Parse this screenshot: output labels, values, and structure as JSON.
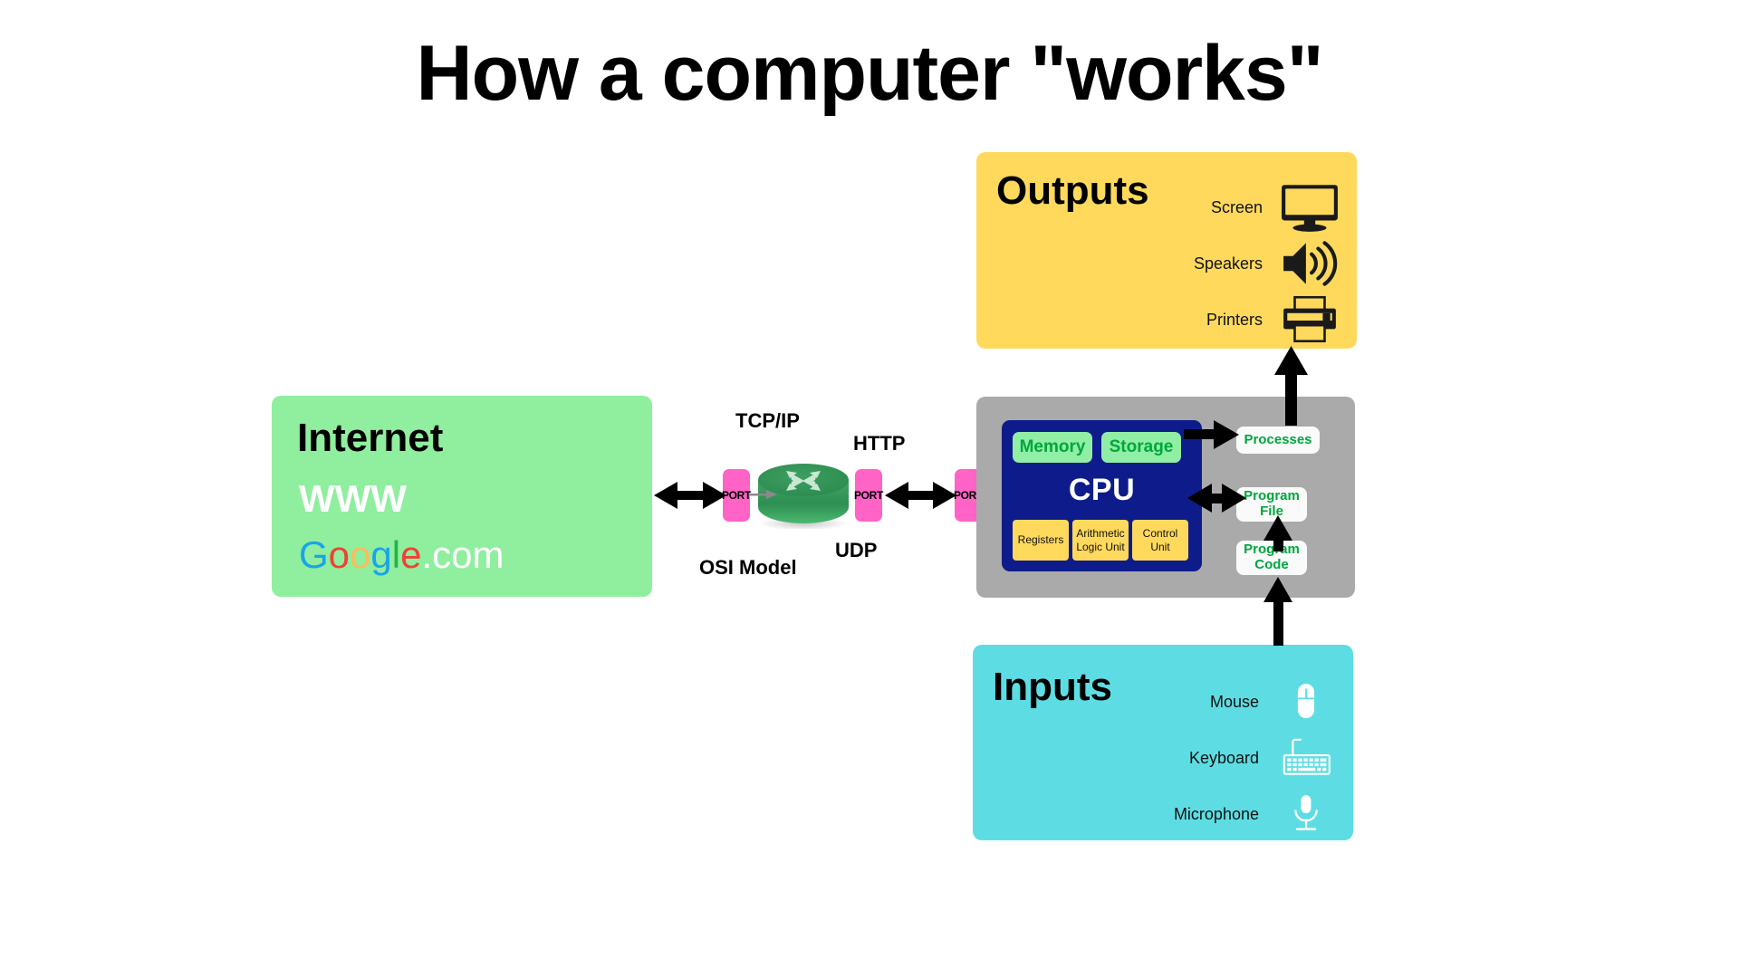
{
  "title": "How a computer \"works\"",
  "internet": {
    "heading": "Internet",
    "www": "WWW",
    "google": {
      "full": "Google.com",
      "letters": [
        {
          "ch": "G",
          "color": "#1AA3E8"
        },
        {
          "ch": "o",
          "color": "#F04134"
        },
        {
          "ch": "o",
          "color": "#FBBC5B"
        },
        {
          "ch": "g",
          "color": "#1AA3E8"
        },
        {
          "ch": "l",
          "color": "#23B34A"
        },
        {
          "ch": "e",
          "color": "#F04134"
        },
        {
          "ch": ".com",
          "color": "#FFFFFF"
        }
      ]
    },
    "bg_color": "#90EE9F"
  },
  "network": {
    "labels": {
      "tcpip": "TCP/IP",
      "http": "HTTP",
      "udp": "UDP",
      "osi": "OSI Model"
    },
    "ports": [
      {
        "label": "PORT",
        "name": "port-internet-side"
      },
      {
        "label": "PORT",
        "name": "port-router-out"
      },
      {
        "label": "PORT",
        "name": "port-computer-side"
      }
    ],
    "port_color": "#FF63C6",
    "router_color": "#2E9E5B",
    "router_icon": "router-icon"
  },
  "computer": {
    "bg_color": "#AAAAAA",
    "cpu": {
      "label": "CPU",
      "bg_color": "#0D1C8A",
      "chips": [
        {
          "label": "Memory",
          "name": "memory-chip"
        },
        {
          "label": "Storage",
          "name": "storage-chip"
        }
      ],
      "chip_color": "#90EEA5",
      "chip_text_color": "#00A63E",
      "units": [
        {
          "label": "Registers",
          "name": "registers-unit"
        },
        {
          "label": "Arithmetic Logic Unit",
          "name": "alu-unit"
        },
        {
          "label": "Control Unit",
          "name": "control-unit"
        }
      ],
      "unit_color": "#FFD95C"
    },
    "side_boxes": [
      {
        "label": "Processes",
        "name": "processes-box"
      },
      {
        "label": "Program File",
        "name": "program-file-box"
      },
      {
        "label": "Program Code",
        "name": "program-code-box"
      }
    ],
    "side_box_text_color": "#00A63E"
  },
  "outputs": {
    "heading": "Outputs",
    "bg_color": "#FFD95C",
    "items": [
      {
        "label": "Screen",
        "icon": "monitor-icon"
      },
      {
        "label": "Speakers",
        "icon": "speaker-icon"
      },
      {
        "label": "Printers",
        "icon": "printer-icon"
      }
    ]
  },
  "inputs": {
    "heading": "Inputs",
    "bg_color": "#5DDDE3",
    "items": [
      {
        "label": "Mouse",
        "icon": "mouse-icon"
      },
      {
        "label": "Keyboard",
        "icon": "keyboard-icon"
      },
      {
        "label": "Microphone",
        "icon": "microphone-icon"
      }
    ]
  }
}
